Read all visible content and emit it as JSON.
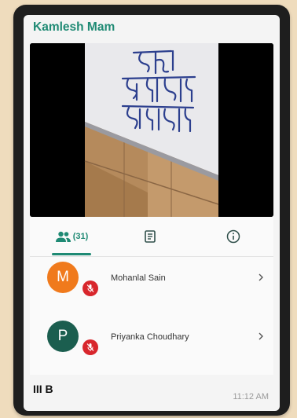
{
  "header": {
    "title": "Kamlesh Mam"
  },
  "video": {
    "handwritten_lines": [
      "ठडा",
      "अंधेरा",
      "बेहादुर"
    ]
  },
  "tabs": [
    {
      "icon": "people-icon",
      "count": "(31)",
      "selected": true
    },
    {
      "icon": "notes-icon"
    },
    {
      "icon": "info-icon"
    }
  ],
  "participants": [
    {
      "initial": "M",
      "name": "Mohanlal Sain",
      "avatar_color": "#f07a1c",
      "muted": true
    },
    {
      "initial": "P",
      "name": "Priyanka Choudhary",
      "avatar_color": "#1b5e4f",
      "muted": true
    }
  ],
  "footer": {
    "group": "III B",
    "time": "11:12 AM"
  },
  "colors": {
    "accent": "#1f8a74",
    "mute": "#d8262c"
  }
}
